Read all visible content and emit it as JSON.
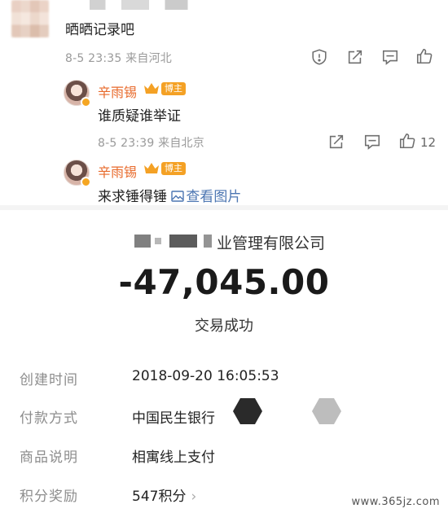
{
  "comment1": {
    "text": "晒晒记录吧",
    "date": "8-5 23:35",
    "location": "来自河北"
  },
  "reply1": {
    "author": "辛雨锡",
    "tag": "博主",
    "text": "谁质疑谁举证",
    "date": "8-5 23:39",
    "location": "来自北京",
    "likes": "12"
  },
  "reply2": {
    "author": "辛雨锡",
    "tag": "博主",
    "text": "来求锤得锤",
    "link": "查看图片"
  },
  "transaction": {
    "company_visible": "业管理有限公司",
    "amount": "-47,045.00",
    "status": "交易成功",
    "rows": [
      {
        "label": "创建时间",
        "value": "2018-09-20 16:05:53"
      },
      {
        "label": "付款方式",
        "value": "中国民生银行"
      },
      {
        "label": "商品说明",
        "value": "相寓线上支付"
      },
      {
        "label": "积分奖励",
        "value": "547积分"
      }
    ],
    "chevron": "›"
  },
  "watermark": "www.365jz.com",
  "colors": {
    "author": "#e86a2b",
    "blogger_tag": "#f4a125",
    "link": "#4c76b2",
    "meta": "#9a9a9a"
  },
  "icons": [
    "report-icon",
    "share-icon",
    "comment-icon",
    "like-icon",
    "image-icon",
    "crown-icon"
  ]
}
